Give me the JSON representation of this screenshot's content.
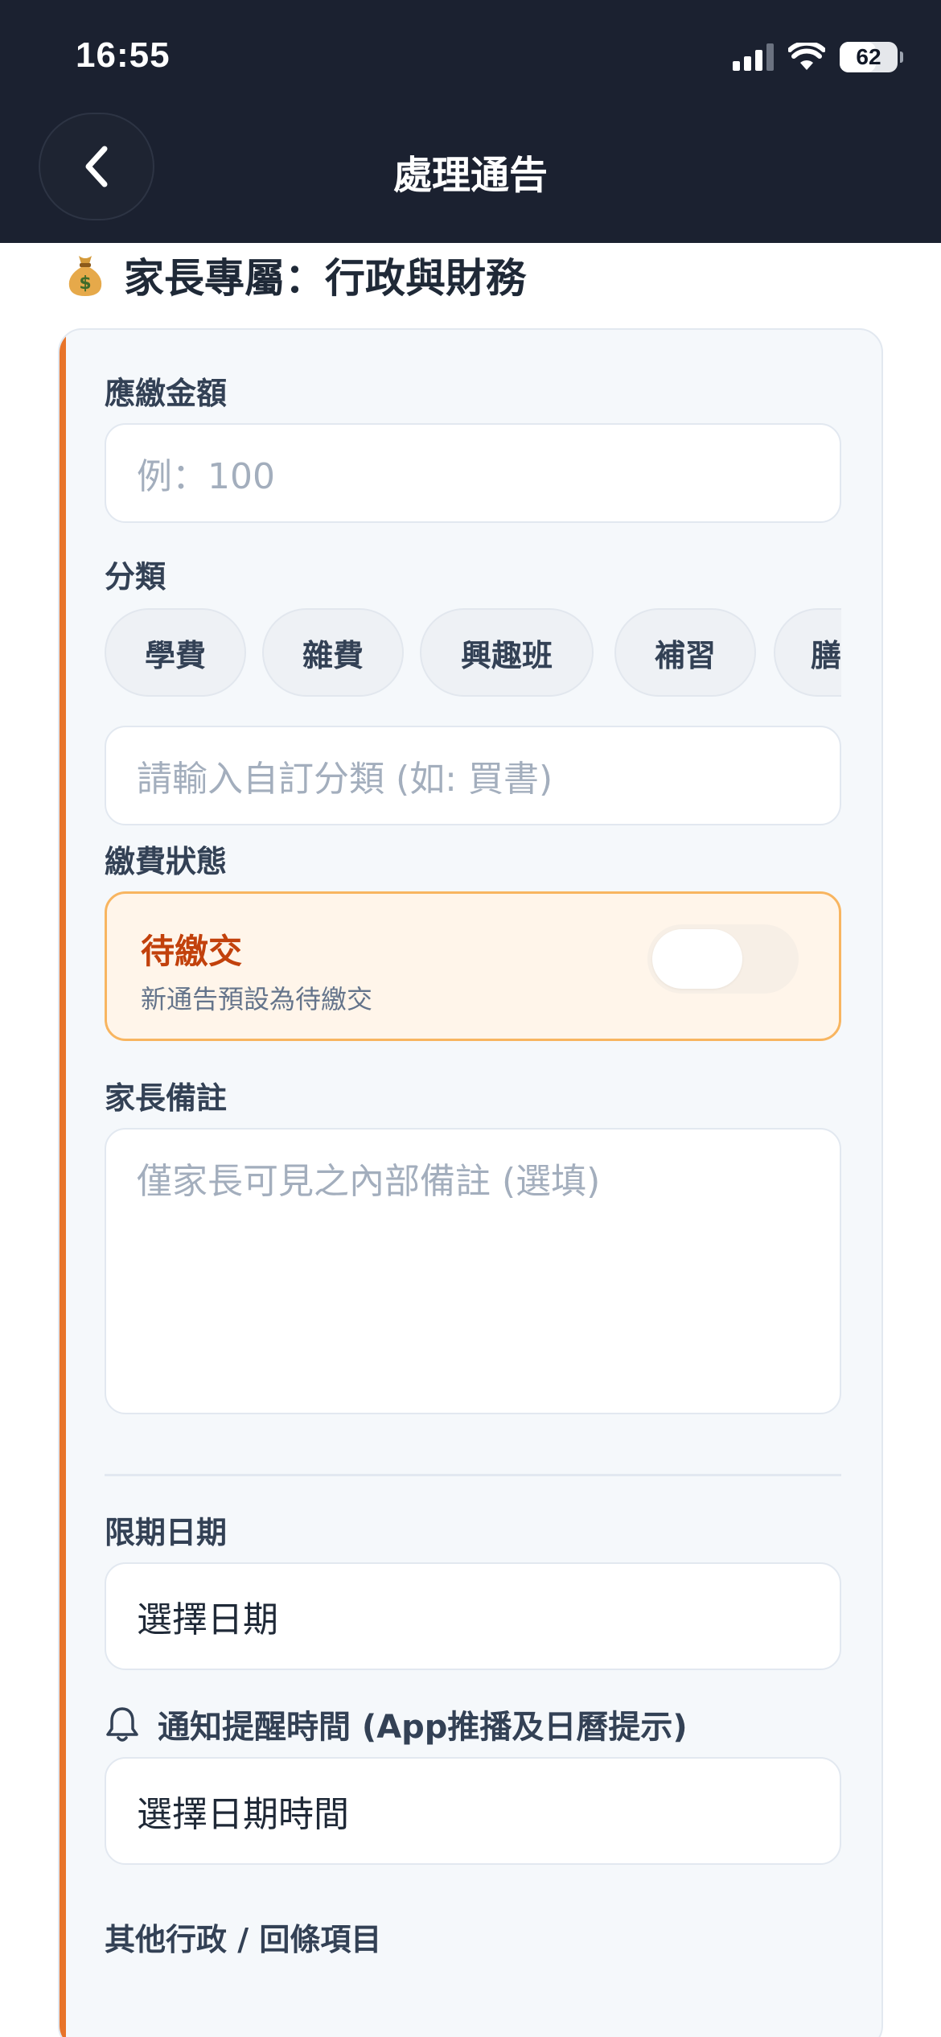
{
  "status_bar": {
    "time": "16:55",
    "battery": "62",
    "battery_level": 0.62
  },
  "header": {
    "title": "處理通告",
    "back_icon": "chevron-left-icon"
  },
  "section": {
    "icon": "money-bag-icon",
    "title": "家長專屬：行政與財務"
  },
  "form": {
    "amount": {
      "label": "應繳金額",
      "placeholder": "例：100"
    },
    "category": {
      "label": "分類",
      "chips": [
        "學費",
        "雜費",
        "興趣班",
        "補習",
        "膳"
      ],
      "custom_placeholder": "請輸入自訂分類 (如: 買書)"
    },
    "payment_status": {
      "label": "繳費狀態",
      "title": "待繳交",
      "subtitle": "新通告預設為待繳交",
      "toggle_on": false
    },
    "parent_note": {
      "label": "家長備註",
      "placeholder": "僅家長可見之內部備註 (選填)"
    },
    "deadline": {
      "label": "限期日期",
      "value": "選擇日期"
    },
    "reminder": {
      "label": "通知提醒時間 (App推播及日曆提示)",
      "value": "選擇日期時間",
      "icon": "bell-icon"
    },
    "other_items_label": "其他行政 / 回條項目"
  },
  "colors": {
    "header_bg": "#1b2130",
    "accent": "#e8742a",
    "status_title": "#c2410c",
    "status_border": "#f8b560",
    "status_bg": "#fff5ea"
  }
}
